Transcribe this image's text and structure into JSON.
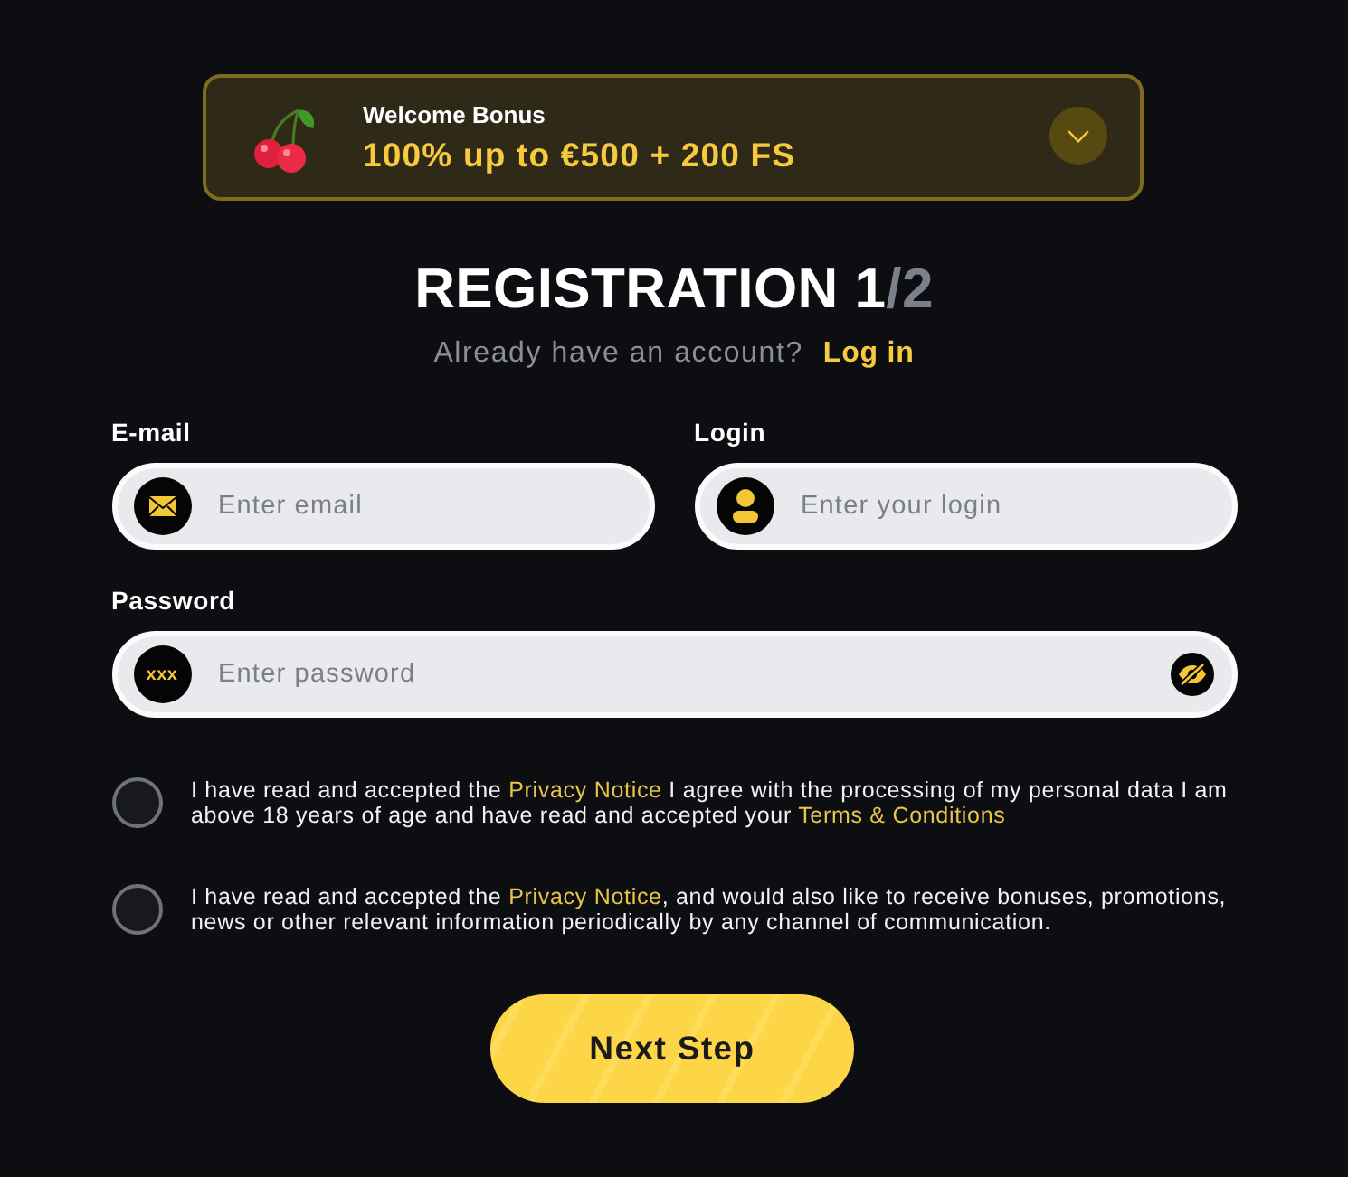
{
  "bonus_banner": {
    "title": "Welcome Bonus",
    "offer": "100% up to €500 + 200 FS",
    "expanded": false
  },
  "heading": {
    "title": "REGISTRATION",
    "step": "1",
    "step_total": "/2"
  },
  "login_prompt": {
    "text": "Already have an account?",
    "link": "Log in"
  },
  "fields": [
    {
      "kind": "email",
      "label": "E-mail",
      "placeholder": "Enter email"
    },
    {
      "kind": "login",
      "label": "Login",
      "placeholder": "Enter your login"
    },
    {
      "kind": "password",
      "label": "Password",
      "placeholder": "Enter password",
      "icon_text": "xxx",
      "show_password": false
    }
  ],
  "consents": [
    {
      "checked": false,
      "parts": [
        {
          "kind": "text",
          "text": "I have read and accepted the "
        },
        {
          "kind": "link",
          "text": "Privacy Notice"
        },
        {
          "kind": "text",
          "text": " I agree with the processing of my personal data I am above 18 years of age and have read and accepted your "
        },
        {
          "kind": "link",
          "text": "Terms & Conditions"
        }
      ]
    },
    {
      "checked": false,
      "parts": [
        {
          "kind": "text",
          "text": "I have read and accepted the "
        },
        {
          "kind": "link",
          "text": "Privacy Notice"
        },
        {
          "kind": "text",
          "text": ", and would also like to receive bonuses, promotions, news or other relevant information periodically by any channel of communication."
        }
      ]
    }
  ],
  "submit_button": {
    "label": "Next Step"
  }
}
